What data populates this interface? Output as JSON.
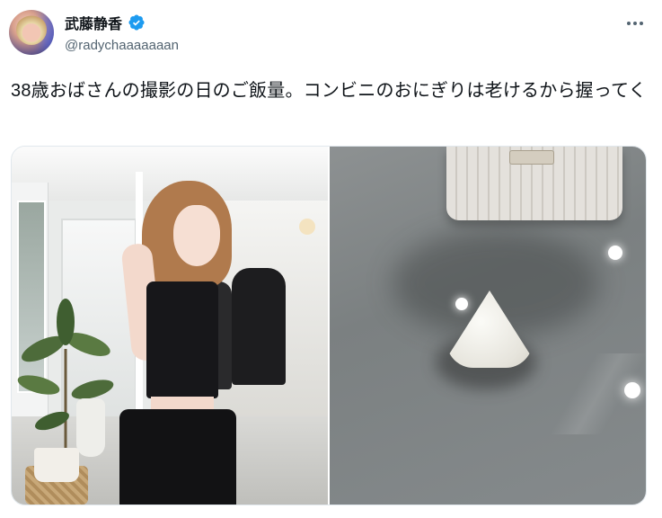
{
  "author": {
    "display_name": "武藤静香",
    "handle": "@radychaaaaaaan",
    "verified": true
  },
  "tweet": {
    "text": "38歳おばさんの撮影の日のご飯量。コンビニのおにぎりは老けるから握ってく"
  },
  "icons": {
    "verified": "verified-badge-icon",
    "more": "more-options-icon"
  },
  "colors": {
    "verified": "#1d9bf0",
    "secondary_text": "#536471",
    "primary_text": "#0f1419"
  }
}
